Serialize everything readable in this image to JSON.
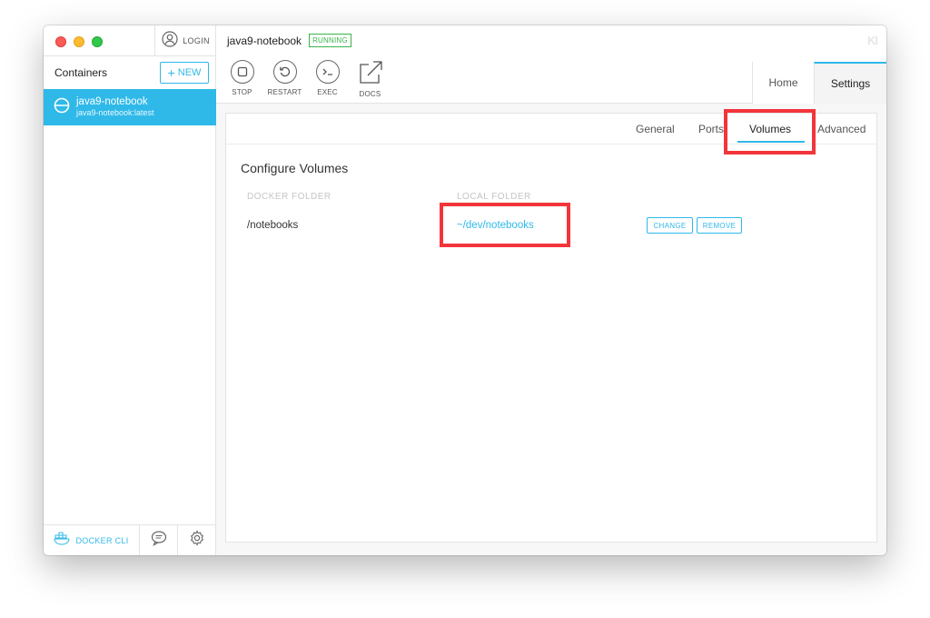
{
  "sidebar": {
    "login_label": "LOGIN",
    "containers_title": "Containers",
    "new_button": {
      "plus": "+",
      "label": "NEW"
    },
    "container": {
      "name": "java9-notebook",
      "image": "java9-notebook:latest"
    },
    "docker_cli_label": "DOCKER CLI"
  },
  "header": {
    "container_title": "java9-notebook",
    "status": "RUNNING",
    "logo_text": "KI",
    "actions": [
      {
        "label": "STOP",
        "icon": "stop-icon"
      },
      {
        "label": "RESTART",
        "icon": "restart-icon"
      },
      {
        "label": "EXEC",
        "icon": "terminal-icon"
      },
      {
        "label": "DOCS",
        "icon": "external-link-icon"
      }
    ],
    "tabs": [
      {
        "label": "Home",
        "active": false
      },
      {
        "label": "Settings",
        "active": true
      }
    ]
  },
  "settings": {
    "subtabs": [
      {
        "label": "General",
        "active": false
      },
      {
        "label": "Ports",
        "active": false
      },
      {
        "label": "Volumes",
        "active": true
      },
      {
        "label": "Advanced",
        "active": false
      }
    ],
    "section_title": "Configure Volumes",
    "columns": {
      "docker": "DOCKER FOLDER",
      "local": "LOCAL FOLDER"
    },
    "volumes": [
      {
        "docker_folder": "/notebooks",
        "local_folder": "~/dev/notebooks",
        "change_label": "CHANGE",
        "remove_label": "REMOVE"
      }
    ]
  },
  "colors": {
    "accent": "#2fb9e9",
    "status_green": "#3ab34a",
    "highlight_red": "#f2353b"
  }
}
